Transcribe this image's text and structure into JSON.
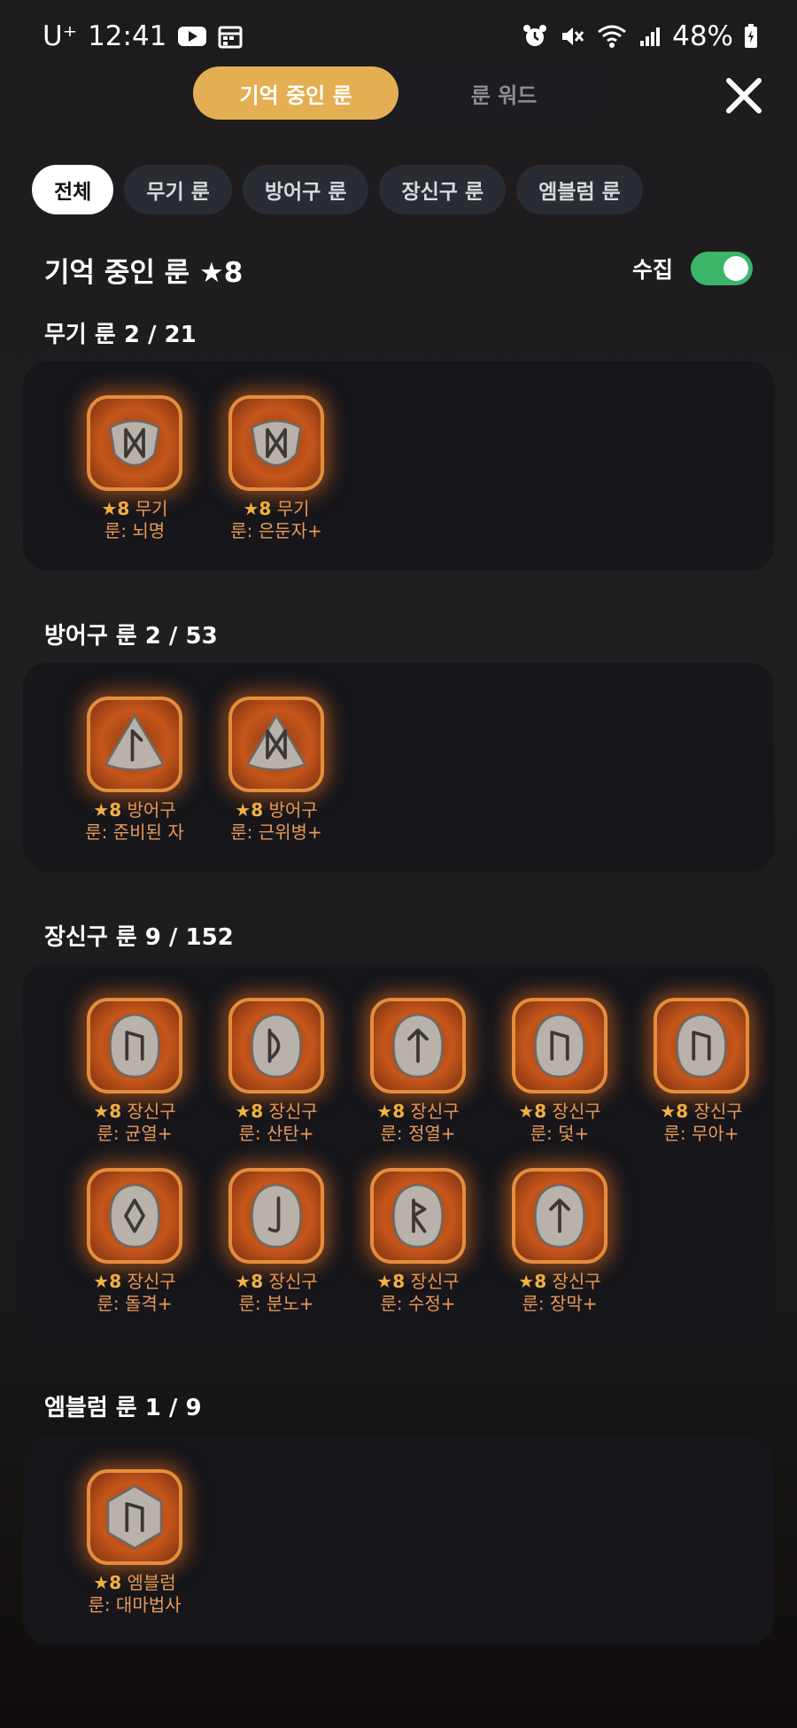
{
  "status_bar": {
    "carrier": "U⁺",
    "time": "12:41",
    "battery": "48%"
  },
  "top_tabs": [
    {
      "label": "기억 중인 룬",
      "active": true
    },
    {
      "label": "룬 워드",
      "active": false
    }
  ],
  "filter_chips": [
    {
      "label": "전체",
      "active": true
    },
    {
      "label": "무기 룬",
      "active": false
    },
    {
      "label": "방어구 룬",
      "active": false
    },
    {
      "label": "장신구 룬",
      "active": false
    },
    {
      "label": "엠블럼 룬",
      "active": false
    }
  ],
  "header": {
    "title": "기억 중인 룬 ★8",
    "collect_label": "수집",
    "collect_on": true
  },
  "sections": [
    {
      "title": "무기 룬  2 / 21",
      "runes": [
        {
          "grade": "★8",
          "line1": "무기",
          "line2": "룬: 뇌명",
          "shape": "shield",
          "glyph": "M"
        },
        {
          "grade": "★8",
          "line1": "무기",
          "line2": "룬: 은둔자+",
          "shape": "shield",
          "glyph": "M"
        }
      ]
    },
    {
      "title": "방어구 룬  2 / 53",
      "runes": [
        {
          "grade": "★8",
          "line1": "방어구",
          "line2": "룬: 준비된 자",
          "shape": "pyramid",
          "glyph": "L"
        },
        {
          "grade": "★8",
          "line1": "방어구",
          "line2": "룬: 근위병+",
          "shape": "pyramid",
          "glyph": "M"
        }
      ]
    },
    {
      "title": "장신구 룬  9 / 152",
      "runes": [
        {
          "grade": "★8",
          "line1": "장신구",
          "line2": "룬: 균열+",
          "shape": "oval",
          "glyph": "U"
        },
        {
          "grade": "★8",
          "line1": "장신구",
          "line2": "룬: 산탄+",
          "shape": "oval",
          "glyph": "D"
        },
        {
          "grade": "★8",
          "line1": "장신구",
          "line2": "룬: 정열+",
          "shape": "oval",
          "glyph": "T"
        },
        {
          "grade": "★8",
          "line1": "장신구",
          "line2": "룬: 덫+",
          "shape": "oval",
          "glyph": "U"
        },
        {
          "grade": "★8",
          "line1": "장신구",
          "line2": "룬: 무아+",
          "shape": "oval",
          "glyph": "U"
        },
        {
          "grade": "★8",
          "line1": "장신구",
          "line2": "룬: 돌격+",
          "shape": "oval",
          "glyph": "O"
        },
        {
          "grade": "★8",
          "line1": "장신구",
          "line2": "룬: 분노+",
          "shape": "oval",
          "glyph": "S"
        },
        {
          "grade": "★8",
          "line1": "장신구",
          "line2": "룬: 수정+",
          "shape": "oval",
          "glyph": "R"
        },
        {
          "grade": "★8",
          "line1": "장신구",
          "line2": "룬: 장막+",
          "shape": "oval",
          "glyph": "T"
        }
      ]
    },
    {
      "title": "엠블럼 룬  1 / 9",
      "runes": [
        {
          "grade": "★8",
          "line1": "엠블럼",
          "line2": "룬: 대마법사",
          "shape": "hex",
          "glyph": "U"
        }
      ]
    }
  ],
  "colors": {
    "accent": "#e4ae52",
    "rune_border": "#e58d3c",
    "rune_text": "#e99a55",
    "toggle_on": "#3cb56a"
  }
}
